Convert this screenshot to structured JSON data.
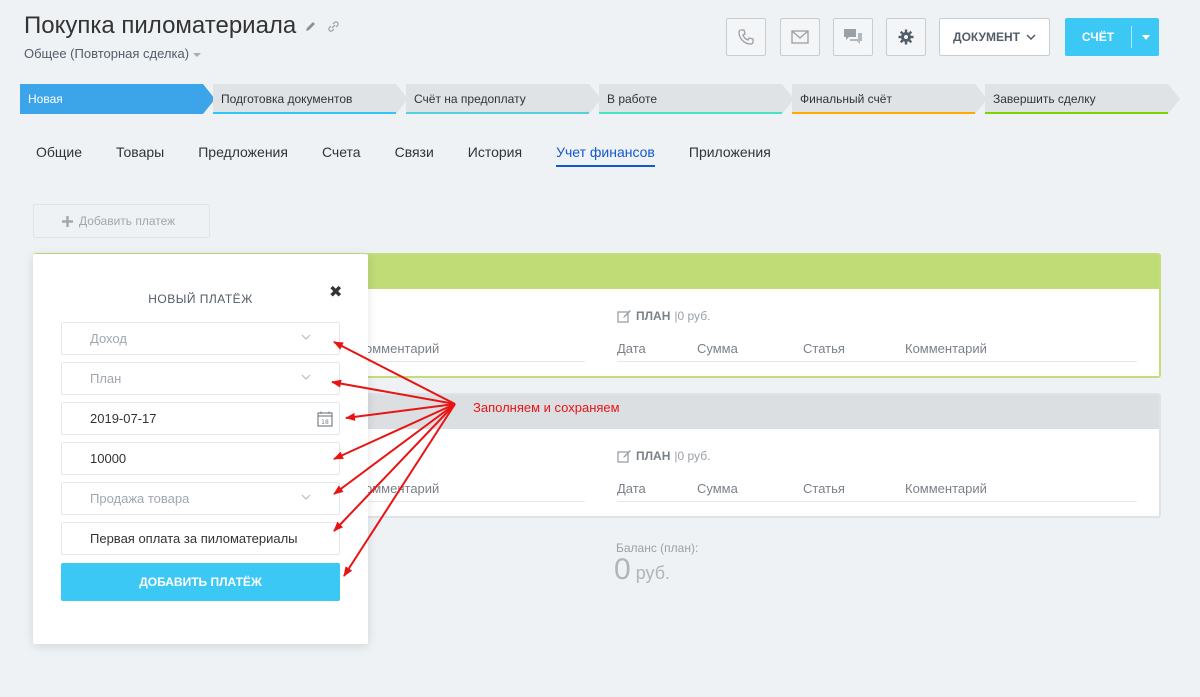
{
  "header": {
    "title": "Покупка пиломатериала",
    "subtitle": "Общее (Повторная сделка)",
    "document_button": "ДОКУМЕНТ",
    "invoice_button": "СЧЁТ"
  },
  "stages": [
    {
      "label": "Новая",
      "color": "#3ca5e9"
    },
    {
      "label": "Подготовка документов",
      "color": "#2fc6f6"
    },
    {
      "label": "Счёт на предоплату",
      "color": "#55d0e0"
    },
    {
      "label": "В работе",
      "color": "#47e4c2"
    },
    {
      "label": "Финальный счёт",
      "color": "#ffa900"
    },
    {
      "label": "Завершить сделку",
      "color": "#7bd500"
    }
  ],
  "tabs": [
    "Общие",
    "Товары",
    "Предложения",
    "Счета",
    "Связи",
    "История",
    "Учет финансов",
    "Приложения"
  ],
  "active_tab": "Учет финансов",
  "add_payment_label": "Добавить платеж",
  "cards": {
    "plan_label": "ПЛАН",
    "plan_value": "|0 руб.",
    "columns": [
      "Дата",
      "Сумма",
      "Статья",
      "Комментарий"
    ],
    "left_column": "омментарий"
  },
  "balance": {
    "label": "Баланс (план):",
    "value": "0",
    "unit": "руб."
  },
  "modal": {
    "title": "НОВЫЙ ПЛАТЁЖ",
    "close": "✖",
    "type_value": "Доход",
    "kind_value": "План",
    "date_value": "2019-07-17",
    "amount_value": "10000",
    "article_value": "Продажа товара",
    "comment_value": "Первая оплата за пиломатериалы",
    "submit_label": "ДОБАВИТЬ ПЛАТЁЖ"
  },
  "annotation": "Заполняем и сохраняем",
  "colors": {
    "accent": "#3bc8f5",
    "annotation": "#e81414",
    "income_header": "#bfdc77"
  }
}
